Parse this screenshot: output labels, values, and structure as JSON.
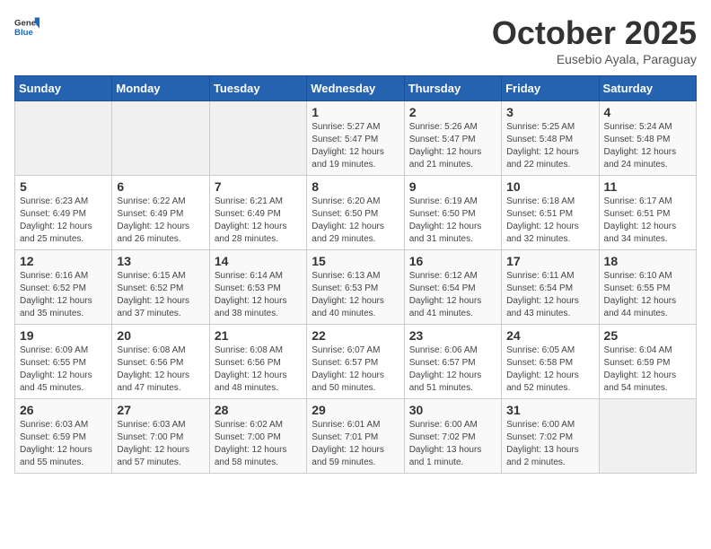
{
  "logo": {
    "general": "General",
    "blue": "Blue"
  },
  "header": {
    "month": "October 2025",
    "location": "Eusebio Ayala, Paraguay"
  },
  "weekdays": [
    "Sunday",
    "Monday",
    "Tuesday",
    "Wednesday",
    "Thursday",
    "Friday",
    "Saturday"
  ],
  "weeks": [
    [
      {
        "day": "",
        "sunrise": "",
        "sunset": "",
        "daylight": ""
      },
      {
        "day": "",
        "sunrise": "",
        "sunset": "",
        "daylight": ""
      },
      {
        "day": "",
        "sunrise": "",
        "sunset": "",
        "daylight": ""
      },
      {
        "day": "1",
        "sunrise": "Sunrise: 5:27 AM",
        "sunset": "Sunset: 5:47 PM",
        "daylight": "Daylight: 12 hours and 19 minutes."
      },
      {
        "day": "2",
        "sunrise": "Sunrise: 5:26 AM",
        "sunset": "Sunset: 5:47 PM",
        "daylight": "Daylight: 12 hours and 21 minutes."
      },
      {
        "day": "3",
        "sunrise": "Sunrise: 5:25 AM",
        "sunset": "Sunset: 5:48 PM",
        "daylight": "Daylight: 12 hours and 22 minutes."
      },
      {
        "day": "4",
        "sunrise": "Sunrise: 5:24 AM",
        "sunset": "Sunset: 5:48 PM",
        "daylight": "Daylight: 12 hours and 24 minutes."
      }
    ],
    [
      {
        "day": "5",
        "sunrise": "Sunrise: 6:23 AM",
        "sunset": "Sunset: 6:49 PM",
        "daylight": "Daylight: 12 hours and 25 minutes."
      },
      {
        "day": "6",
        "sunrise": "Sunrise: 6:22 AM",
        "sunset": "Sunset: 6:49 PM",
        "daylight": "Daylight: 12 hours and 26 minutes."
      },
      {
        "day": "7",
        "sunrise": "Sunrise: 6:21 AM",
        "sunset": "Sunset: 6:49 PM",
        "daylight": "Daylight: 12 hours and 28 minutes."
      },
      {
        "day": "8",
        "sunrise": "Sunrise: 6:20 AM",
        "sunset": "Sunset: 6:50 PM",
        "daylight": "Daylight: 12 hours and 29 minutes."
      },
      {
        "day": "9",
        "sunrise": "Sunrise: 6:19 AM",
        "sunset": "Sunset: 6:50 PM",
        "daylight": "Daylight: 12 hours and 31 minutes."
      },
      {
        "day": "10",
        "sunrise": "Sunrise: 6:18 AM",
        "sunset": "Sunset: 6:51 PM",
        "daylight": "Daylight: 12 hours and 32 minutes."
      },
      {
        "day": "11",
        "sunrise": "Sunrise: 6:17 AM",
        "sunset": "Sunset: 6:51 PM",
        "daylight": "Daylight: 12 hours and 34 minutes."
      }
    ],
    [
      {
        "day": "12",
        "sunrise": "Sunrise: 6:16 AM",
        "sunset": "Sunset: 6:52 PM",
        "daylight": "Daylight: 12 hours and 35 minutes."
      },
      {
        "day": "13",
        "sunrise": "Sunrise: 6:15 AM",
        "sunset": "Sunset: 6:52 PM",
        "daylight": "Daylight: 12 hours and 37 minutes."
      },
      {
        "day": "14",
        "sunrise": "Sunrise: 6:14 AM",
        "sunset": "Sunset: 6:53 PM",
        "daylight": "Daylight: 12 hours and 38 minutes."
      },
      {
        "day": "15",
        "sunrise": "Sunrise: 6:13 AM",
        "sunset": "Sunset: 6:53 PM",
        "daylight": "Daylight: 12 hours and 40 minutes."
      },
      {
        "day": "16",
        "sunrise": "Sunrise: 6:12 AM",
        "sunset": "Sunset: 6:54 PM",
        "daylight": "Daylight: 12 hours and 41 minutes."
      },
      {
        "day": "17",
        "sunrise": "Sunrise: 6:11 AM",
        "sunset": "Sunset: 6:54 PM",
        "daylight": "Daylight: 12 hours and 43 minutes."
      },
      {
        "day": "18",
        "sunrise": "Sunrise: 6:10 AM",
        "sunset": "Sunset: 6:55 PM",
        "daylight": "Daylight: 12 hours and 44 minutes."
      }
    ],
    [
      {
        "day": "19",
        "sunrise": "Sunrise: 6:09 AM",
        "sunset": "Sunset: 6:55 PM",
        "daylight": "Daylight: 12 hours and 45 minutes."
      },
      {
        "day": "20",
        "sunrise": "Sunrise: 6:08 AM",
        "sunset": "Sunset: 6:56 PM",
        "daylight": "Daylight: 12 hours and 47 minutes."
      },
      {
        "day": "21",
        "sunrise": "Sunrise: 6:08 AM",
        "sunset": "Sunset: 6:56 PM",
        "daylight": "Daylight: 12 hours and 48 minutes."
      },
      {
        "day": "22",
        "sunrise": "Sunrise: 6:07 AM",
        "sunset": "Sunset: 6:57 PM",
        "daylight": "Daylight: 12 hours and 50 minutes."
      },
      {
        "day": "23",
        "sunrise": "Sunrise: 6:06 AM",
        "sunset": "Sunset: 6:57 PM",
        "daylight": "Daylight: 12 hours and 51 minutes."
      },
      {
        "day": "24",
        "sunrise": "Sunrise: 6:05 AM",
        "sunset": "Sunset: 6:58 PM",
        "daylight": "Daylight: 12 hours and 52 minutes."
      },
      {
        "day": "25",
        "sunrise": "Sunrise: 6:04 AM",
        "sunset": "Sunset: 6:59 PM",
        "daylight": "Daylight: 12 hours and 54 minutes."
      }
    ],
    [
      {
        "day": "26",
        "sunrise": "Sunrise: 6:03 AM",
        "sunset": "Sunset: 6:59 PM",
        "daylight": "Daylight: 12 hours and 55 minutes."
      },
      {
        "day": "27",
        "sunrise": "Sunrise: 6:03 AM",
        "sunset": "Sunset: 7:00 PM",
        "daylight": "Daylight: 12 hours and 57 minutes."
      },
      {
        "day": "28",
        "sunrise": "Sunrise: 6:02 AM",
        "sunset": "Sunset: 7:00 PM",
        "daylight": "Daylight: 12 hours and 58 minutes."
      },
      {
        "day": "29",
        "sunrise": "Sunrise: 6:01 AM",
        "sunset": "Sunset: 7:01 PM",
        "daylight": "Daylight: 12 hours and 59 minutes."
      },
      {
        "day": "30",
        "sunrise": "Sunrise: 6:00 AM",
        "sunset": "Sunset: 7:02 PM",
        "daylight": "Daylight: 13 hours and 1 minute."
      },
      {
        "day": "31",
        "sunrise": "Sunrise: 6:00 AM",
        "sunset": "Sunset: 7:02 PM",
        "daylight": "Daylight: 13 hours and 2 minutes."
      },
      {
        "day": "",
        "sunrise": "",
        "sunset": "",
        "daylight": ""
      }
    ]
  ]
}
